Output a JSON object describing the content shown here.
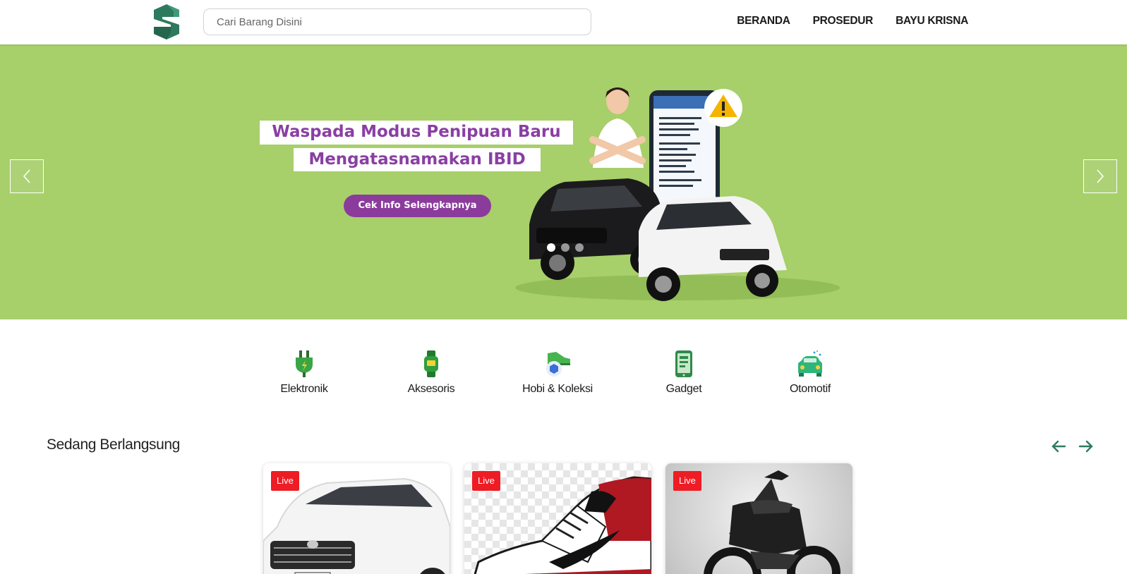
{
  "header": {
    "search_placeholder": "Cari Barang Disini",
    "nav": [
      "BERANDA",
      "PROSEDUR",
      "BAYU KRISNA"
    ],
    "logo_letter": "S",
    "brand_color": "#2e7a5e"
  },
  "banner": {
    "title_line1": "Waspada Modus Penipuan Baru",
    "title_line2": "Mengatasnamakan IBID",
    "cta_label": "Cek Info Selengkapnya",
    "background": "#a7cf6a",
    "slides_total": 3,
    "active_slide": 1
  },
  "categories": [
    {
      "label": "Elektronik",
      "icon": "plug-icon"
    },
    {
      "label": "Aksesoris",
      "icon": "watch-icon"
    },
    {
      "label": "Hobi & Koleksi",
      "icon": "sneaker-icon"
    },
    {
      "label": "Gadget",
      "icon": "phone-icon"
    },
    {
      "label": "Otomotif",
      "icon": "car-icon"
    }
  ],
  "live_section": {
    "title": "Sedang Berlangsung",
    "cards": [
      {
        "badge": "Live",
        "item": "car"
      },
      {
        "badge": "Live",
        "item": "sneaker"
      },
      {
        "badge": "Live",
        "item": "motorbike"
      }
    ]
  }
}
